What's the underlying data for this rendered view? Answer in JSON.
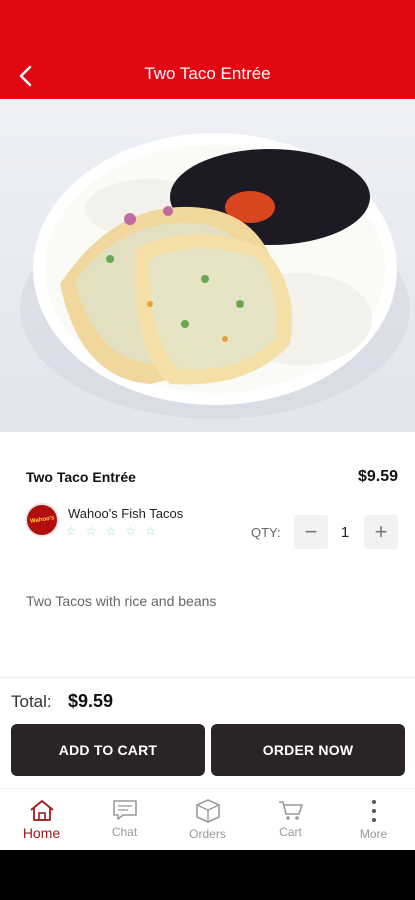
{
  "header": {
    "title": "Two Taco Entrée",
    "back_icon": "chevron-left-icon",
    "background": "#e30613"
  },
  "item": {
    "name": "Two Taco Entrée",
    "price": "$9.59",
    "description": "Two Tacos with rice and beans"
  },
  "restaurant": {
    "name": "Wahoo's Fish Tacos",
    "logo_text": "Wahoo's",
    "rating_icon": "star-outline-icon",
    "rating_stars": 5,
    "star_color": "#9be3e0"
  },
  "quantity": {
    "label": "QTY:",
    "value": "1",
    "minus": "−",
    "plus": "+"
  },
  "footer": {
    "total_label": "Total:",
    "total_value": "$9.59",
    "add_to_cart": "ADD TO CART",
    "order_now": "ORDER NOW",
    "button_color": "#2b2424"
  },
  "tabs": [
    {
      "label": "Home",
      "icon": "home-icon",
      "active": true
    },
    {
      "label": "Chat",
      "icon": "chat-icon",
      "active": false
    },
    {
      "label": "Orders",
      "icon": "box-icon",
      "active": false
    },
    {
      "label": "Cart",
      "icon": "cart-icon",
      "active": false
    },
    {
      "label": "More",
      "icon": "more-vertical-icon",
      "active": false
    }
  ],
  "colors": {
    "accent": "#a11b1b",
    "inactive": "#9a9a9a"
  }
}
